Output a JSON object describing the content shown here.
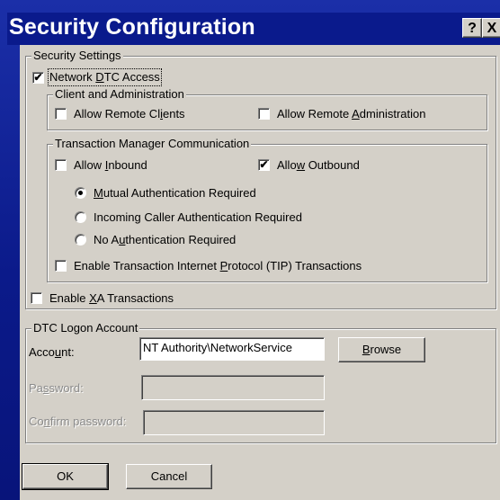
{
  "window": {
    "title": "Security Configuration",
    "help_glyph": "?",
    "close_glyph": "X"
  },
  "security_settings": {
    "legend": "Security Settings",
    "network_dtc_access": {
      "label_pre": "Network ",
      "label_u": "D",
      "label_post": "TC Access",
      "checked": true
    },
    "client_admin": {
      "legend": "Client and Administration",
      "allow_remote_clients": {
        "label_pre": "Allow Remote Cl",
        "label_u": "i",
        "label_post": "ents",
        "checked": false
      },
      "allow_remote_admin": {
        "label_pre": "Allow Remote ",
        "label_u": "A",
        "label_post": "dministration",
        "checked": false
      }
    },
    "tm_comm": {
      "legend": "Transaction Manager Communication",
      "allow_inbound": {
        "label_pre": "Allow ",
        "label_u": "I",
        "label_post": "nbound",
        "checked": false
      },
      "allow_outbound": {
        "label_pre": "Allo",
        "label_u": "w",
        "label_post": " Outbound",
        "checked": true
      },
      "radios": [
        {
          "label_pre": "",
          "label_u": "M",
          "label_post": "utual Authentication Required",
          "selected": true
        },
        {
          "label_pre": "Incoming Caller Authentication Required",
          "label_u": "",
          "label_post": "",
          "selected": false
        },
        {
          "label_pre": "No A",
          "label_u": "u",
          "label_post": "thentication Required",
          "selected": false
        }
      ],
      "tip": {
        "label_pre": "Enable Transaction Internet ",
        "label_u": "P",
        "label_post": "rotocol (TIP) Transactions",
        "checked": false
      }
    },
    "xa": {
      "label_pre": "Enable ",
      "label_u": "X",
      "label_post": "A Transactions",
      "checked": false
    }
  },
  "logon": {
    "legend": "DTC Logon Account",
    "account_label_pre": "Acco",
    "account_label_u": "u",
    "account_label_post": "nt:",
    "account_value": "NT Authority\\NetworkService",
    "browse_u": "B",
    "browse_post": "rowse",
    "password_label_pre": "Pa",
    "password_label_u": "s",
    "password_label_post": "sword:",
    "password_value": "",
    "confirm_label_pre": "Co",
    "confirm_label_u": "n",
    "confirm_label_post": "firm password:",
    "confirm_value": ""
  },
  "buttons": {
    "ok": "OK",
    "cancel": "Cancel"
  },
  "colors": {
    "title_bg": "#0a1a8c",
    "dialog_bg": "#d4d0c8",
    "disabled_text": "#8a8a8a"
  }
}
